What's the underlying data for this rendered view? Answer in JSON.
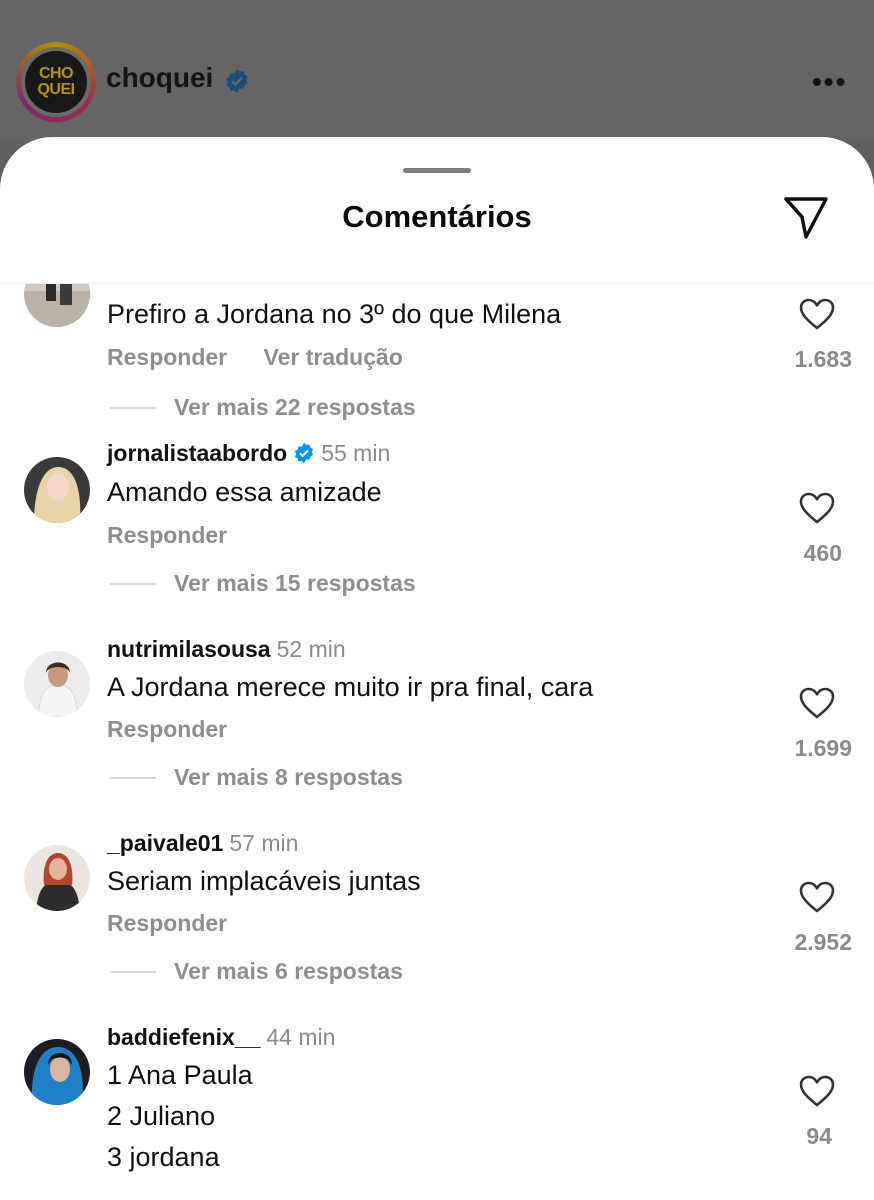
{
  "post_header": {
    "avatar_text_line1": "CHO",
    "avatar_text_line2": "QUEI",
    "username": "choquei",
    "verified_icon": "verified-badge-icon",
    "more_label": "•••"
  },
  "sheet": {
    "title": "Comentários",
    "share_icon": "send-icon"
  },
  "comments": [
    {
      "text": "Prefiro a Jordana no 3º do que Milena",
      "reply_label": "Responder",
      "translate_label": "Ver tradução",
      "likes": "1.683",
      "replies_label": "Ver mais 22 respostas"
    },
    {
      "username": "jornalistaabordo",
      "verified": true,
      "time": "55 min",
      "text": "Amando essa amizade",
      "reply_label": "Responder",
      "likes": "460",
      "replies_label": "Ver mais 15 respostas"
    },
    {
      "username": "nutrimilasousa",
      "time": "52 min",
      "text": "A Jordana merece muito ir pra final, cara",
      "reply_label": "Responder",
      "likes": "1.699",
      "replies_label": "Ver mais 8 respostas"
    },
    {
      "username": "_paivale01",
      "time": "57 min",
      "text": "Seriam implacáveis juntas",
      "reply_label": "Responder",
      "likes": "2.952",
      "replies_label": "Ver mais 6 respostas"
    },
    {
      "username": "baddiefenix__",
      "time": "44 min",
      "text_lines": [
        "1 Ana Paula",
        "2 Juliano",
        "3 jordana"
      ],
      "likes": "94"
    }
  ],
  "colors": {
    "overlay": "#5f6062",
    "sheet": "#ffffff",
    "verified": "#0095f6",
    "muted": "#8e8e8e"
  }
}
